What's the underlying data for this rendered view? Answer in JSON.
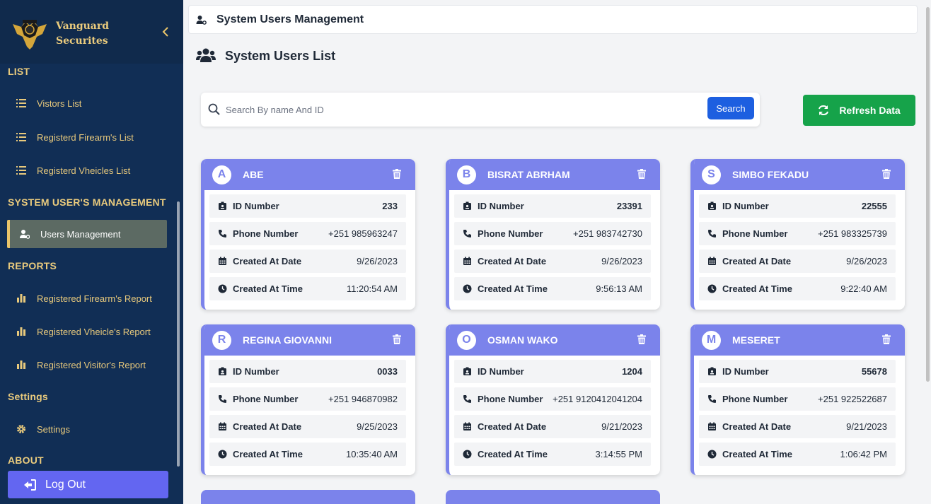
{
  "brand": {
    "line1": "Vanguard",
    "line2": "Securites"
  },
  "sidebar": {
    "sections": {
      "list": "LIST",
      "users": "SYSTEM USER'S MANAGEMENT",
      "reports": "REPORTS",
      "settings": "Settings",
      "about": "ABOUT"
    },
    "items": [
      {
        "label": "Vistors List",
        "icon": "list-icon"
      },
      {
        "label": "Registerd Firearm's List",
        "icon": "list-icon"
      },
      {
        "label": "Registerd Vheicles List",
        "icon": "list-icon"
      },
      {
        "label": "Users Management",
        "icon": "user-gear-icon",
        "active": true
      },
      {
        "label": "Registered Firearm's Report",
        "icon": "bar-chart-icon"
      },
      {
        "label": "Registered Vheicle's Report",
        "icon": "bar-chart-icon"
      },
      {
        "label": "Registered Visitor's Report",
        "icon": "bar-chart-icon"
      },
      {
        "label": "Settings",
        "icon": "gear-icon"
      }
    ],
    "logout": "Log Out"
  },
  "topbar": {
    "title": "System Users Management"
  },
  "page": {
    "title": "System Users List"
  },
  "search": {
    "placeholder": "Search By name And ID",
    "button": "Search"
  },
  "refresh": {
    "label": "Refresh Data"
  },
  "labels": {
    "id": "ID Number",
    "phone": "Phone Number",
    "date": "Created At Date",
    "time": "Created At Time"
  },
  "users": [
    {
      "initial": "A",
      "name": "ABE",
      "id": "233",
      "phone": "+251 985963247",
      "date": "9/26/2023",
      "time": "11:20:54 AM"
    },
    {
      "initial": "B",
      "name": "BISRAT ABRHAM",
      "id": "23391",
      "phone": "+251 983742730",
      "date": "9/26/2023",
      "time": "9:56:13 AM"
    },
    {
      "initial": "S",
      "name": "SIMBO FEKADU",
      "id": "22555",
      "phone": "+251 983325739",
      "date": "9/26/2023",
      "time": "9:22:40 AM"
    },
    {
      "initial": "R",
      "name": "REGINA GIOVANNI",
      "id": "0033",
      "phone": "+251 946870982",
      "date": "9/25/2023",
      "time": "10:35:40 AM"
    },
    {
      "initial": "O",
      "name": "OSMAN WAKO",
      "id": "1204",
      "phone": "+251 9120412041204",
      "date": "9/21/2023",
      "time": "3:14:55 PM"
    },
    {
      "initial": "M",
      "name": "MESERET",
      "id": "55678",
      "phone": "+251 922522687",
      "date": "9/21/2023",
      "time": "1:06:42 PM"
    }
  ],
  "colors": {
    "sidebar": "#112e55",
    "gold": "#e9c46a",
    "card_header": "#7b83eb",
    "search_button": "#1d5fe0",
    "refresh_button": "#16a34a",
    "logout": "#6366f1"
  }
}
